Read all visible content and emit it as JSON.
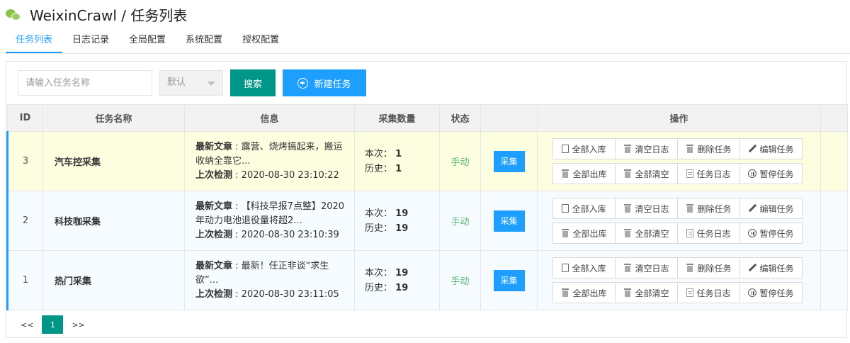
{
  "app": {
    "title": "WeixinCrawl / 任务列表"
  },
  "tabs": [
    "任务列表",
    "日志记录",
    "全局配置",
    "系统配置",
    "授权配置"
  ],
  "toolbar": {
    "search_placeholder": "请输入任务名称",
    "select_value": "默认",
    "search_label": "搜索",
    "new_label": "新建任务"
  },
  "table": {
    "headers": [
      "ID",
      "任务名称",
      "信息",
      "采集数量",
      "状态",
      "",
      "操作",
      ""
    ],
    "info_article_label": "最新文章",
    "info_check_label": "上次检测",
    "count_now_label": "本次",
    "count_history_label": "历史",
    "collect_label": "采集",
    "ops": [
      "全部入库",
      "清空日志",
      "删除任务",
      "编辑任务",
      "全部出库",
      "全部清空",
      "任务日志",
      "暂停任务"
    ],
    "rows": [
      {
        "id": "3",
        "name": "汽车控采集",
        "article": "露营、烧烤搞起来，搬运收纳全靠它...",
        "checked": "2020-08-30 23:10:22",
        "now": "1",
        "history": "1",
        "status": "手动"
      },
      {
        "id": "2",
        "name": "科技咖采集",
        "article": "【科技早报7点整】2020年动力电池退役量将超2...",
        "checked": "2020-08-30 23:10:39",
        "now": "19",
        "history": "19",
        "status": "手动"
      },
      {
        "id": "1",
        "name": "热门采集",
        "article": "最新！任正非谈“求生欲”...",
        "checked": "2020-08-30 23:11:05",
        "now": "19",
        "history": "19",
        "status": "手动"
      }
    ]
  },
  "pager": {
    "prev": "<<",
    "current": "1",
    "next": ">>"
  }
}
